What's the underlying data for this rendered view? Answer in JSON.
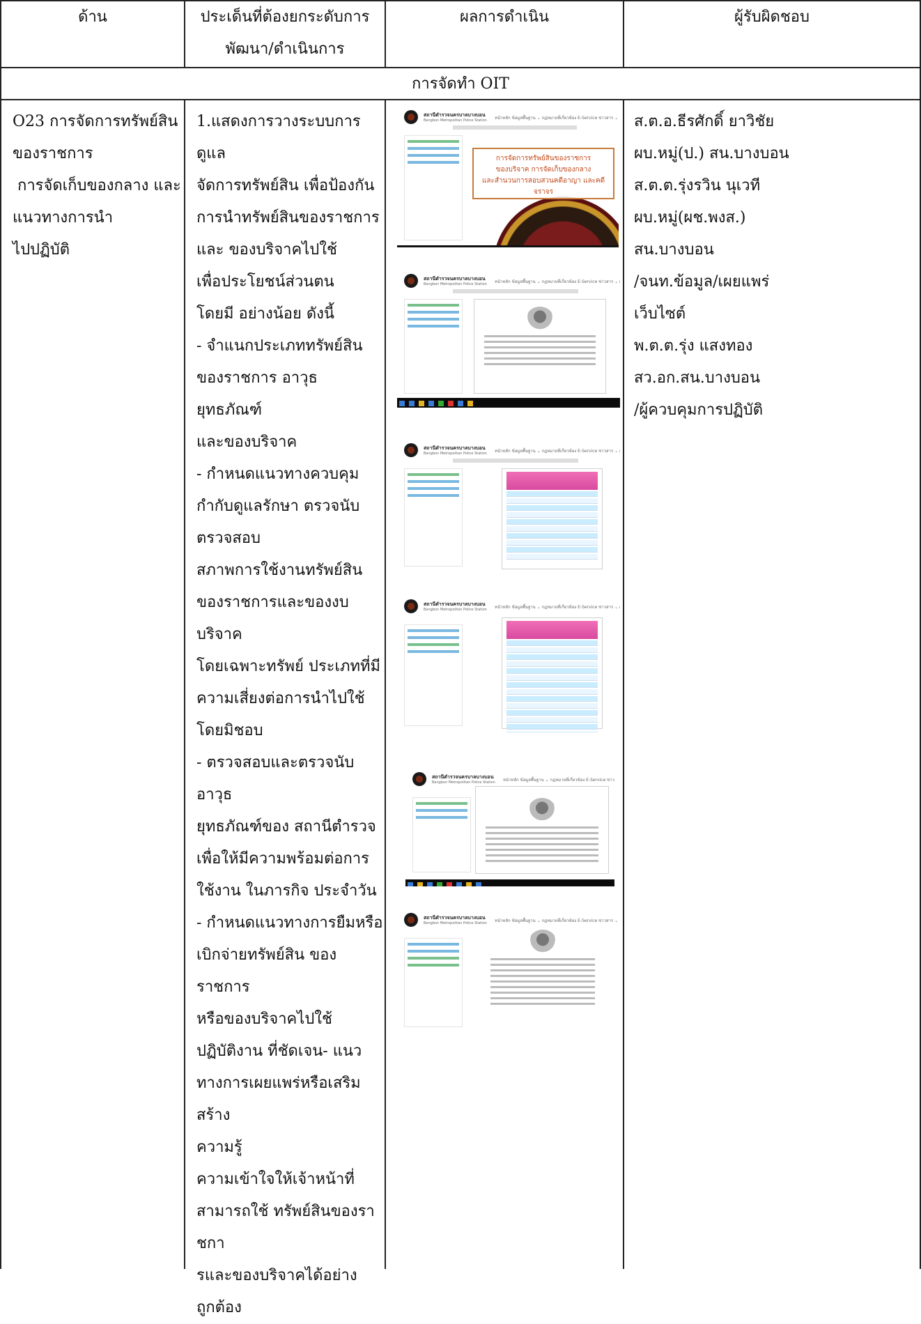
{
  "header": {
    "col1": "ด้าน",
    "col2_line1": "ประเด็นที่ต้องยกระดับการ",
    "col2_line2": "พัฒนา/ดำเนินการ",
    "col3": "ผลการดำเนิน",
    "col4": "ผู้รับผิดชอบ"
  },
  "section_title": "การจัดทำ OIT",
  "row": {
    "aspect_lines": [
      "O23 การจัดการทรัพย์สิน",
      "ของราชการ",
      " การจัดเก็บของกลาง และ",
      "แนวทางการนำ",
      "ไปปฏิบัติ"
    ],
    "issue_lines": [
      "1.แสดงการวางระบบการดูแล",
      "จัดการทรัพย์สิน เพื่อป้องกัน",
      "การนำทรัพย์สินของราชการ",
      "และ ของบริจาคไปใช้",
      "เพื่อประโยชน์ส่วนตน",
      "โดยมี อย่างน้อย ดังนี้",
      "- จำแนกประเภททรัพย์สิน",
      "ของราชการ อาวุธ ยุทธภัณฑ์",
      "และของบริจาค",
      "- กำหนดแนวทางควบคุม",
      "กำกับดูแลรักษา ตรวจนับ",
      "ตรวจสอบ",
      "สภาพการใช้งานทรัพย์สิน",
      "ของราชการและของงบบริจาค",
      "โดยเฉพาะทรัพย์ ประเภทที่มี",
      "ความเสี่ยงต่อการนำไปใช้",
      "โดยมิชอบ",
      "- ตรวจสอบและตรวจนับอาวุธ",
      "ยุทธภัณฑ์ของ สถานีตำรวจ",
      "เพื่อให้มีความพร้อมต่อการ",
      "ใช้งาน ในภารกิจ ประจำวัน",
      "- กำหนดแนวทางการยืมหรือ",
      "เบิกจ่ายทรัพย์สิน ของราชการ",
      "หรือของบริจาคไปใช้",
      "ปฏิบัติงาน ที่ชัดเจน- แนว",
      "ทางการเผยแพร่หรือเสริมสร้าง",
      "ความรู้",
      "ความเข้าใจให้เจ้าหน้าที่",
      "สามารถใช้ ทรัพย์สินของรา",
      "ชกา",
      "รและของบริจาคได้อย่าง",
      "ถูกต้อง"
    ],
    "responsible_lines": [
      "ส.ต.อ.ธีรศักดิ์ ยาวิชัย",
      "ผบ.หมู่(ป.) สน.บางบอน",
      "ส.ต.ต.รุ่งรวิน นุเวที",
      "ผบ.หมู่(ผช.พงส.)",
      "สน.บางบอน",
      "/จนท.ข้อมูล/เผยแพร่",
      "เว็บไซต์",
      "พ.ต.ต.รุ่ง แสงทอง",
      "สว.อก.สน.บางบอน",
      "/ผู้ควบคุมการปฏิบัติ"
    ]
  },
  "screenshots": {
    "site_name": "สถานีตำรวจนครบาลบางบอน",
    "site_name_en": "Bangbon Metropolitan Police Station",
    "menu": "หน้าหลัก   ข้อมูลพื้นฐาน ⌄   กฎหมายที่เกี่ยวข้อง   E-Service   ข่าวสาร ⌄   ผลงาน ITA ⌄",
    "title_lines": [
      "การจัดการทรัพย์สินของราชการ",
      "ของบริจาค การจัดเก็บของกลาง",
      "และสำนวนการสอบสวนคดีอาญา และคดีจราจร"
    ]
  }
}
